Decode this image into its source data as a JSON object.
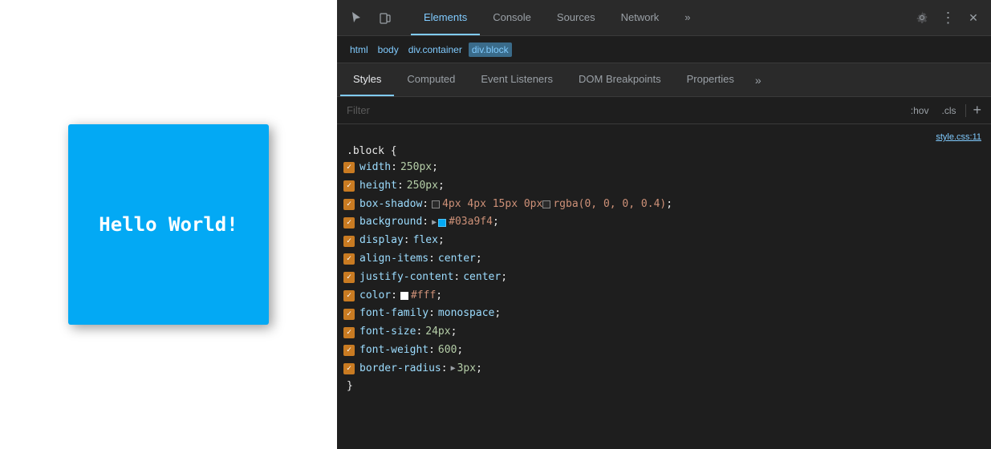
{
  "webpage": {
    "hello_text": "Hello World!"
  },
  "devtools": {
    "toolbar": {
      "cursor_icon": "⬆",
      "device_icon": "▭",
      "tabs": [
        {
          "label": "Elements",
          "active": true
        },
        {
          "label": "Console",
          "active": false
        },
        {
          "label": "Sources",
          "active": false
        },
        {
          "label": "Network",
          "active": false
        }
      ],
      "more_icon": "»",
      "settings_icon": "⚙",
      "menu_icon": "⋮",
      "close_icon": "✕"
    },
    "breadcrumb": {
      "items": [
        "html",
        "body",
        "div.container",
        "div.block"
      ]
    },
    "styles_tabs": {
      "tabs": [
        {
          "label": "Styles",
          "active": true
        },
        {
          "label": "Computed",
          "active": false
        },
        {
          "label": "Event Listeners",
          "active": false
        },
        {
          "label": "DOM Breakpoints",
          "active": false
        },
        {
          "label": "Properties",
          "active": false
        }
      ],
      "more": "»"
    },
    "filter": {
      "placeholder": "Filter",
      "hov_label": ":hov",
      "cls_label": ".cls",
      "add_label": "+"
    },
    "css_rule": {
      "selector": ".block {",
      "source": "style.css:11",
      "properties": [
        {
          "name": "width",
          "value": "250px",
          "type": "numeric"
        },
        {
          "name": "height",
          "value": "250px",
          "type": "numeric"
        },
        {
          "name": "box-shadow",
          "value": "4px 4px 15px 0px",
          "color": null,
          "color2": "rgba(0, 0, 0, 0.4)",
          "type": "shadow"
        },
        {
          "name": "background",
          "value": "#03a9f4",
          "type": "color-blue"
        },
        {
          "name": "display",
          "value": "flex",
          "type": "keyword"
        },
        {
          "name": "align-items",
          "value": "center",
          "type": "keyword"
        },
        {
          "name": "justify-content",
          "value": "center",
          "type": "keyword"
        },
        {
          "name": "color",
          "value": "#fff",
          "type": "color-white"
        },
        {
          "name": "font-family",
          "value": "monospace",
          "type": "keyword"
        },
        {
          "name": "font-size",
          "value": "24px",
          "type": "numeric"
        },
        {
          "name": "font-weight",
          "value": "600",
          "type": "numeric"
        },
        {
          "name": "border-radius",
          "value": "3px",
          "type": "expandable-numeric"
        }
      ],
      "close": "}"
    }
  }
}
